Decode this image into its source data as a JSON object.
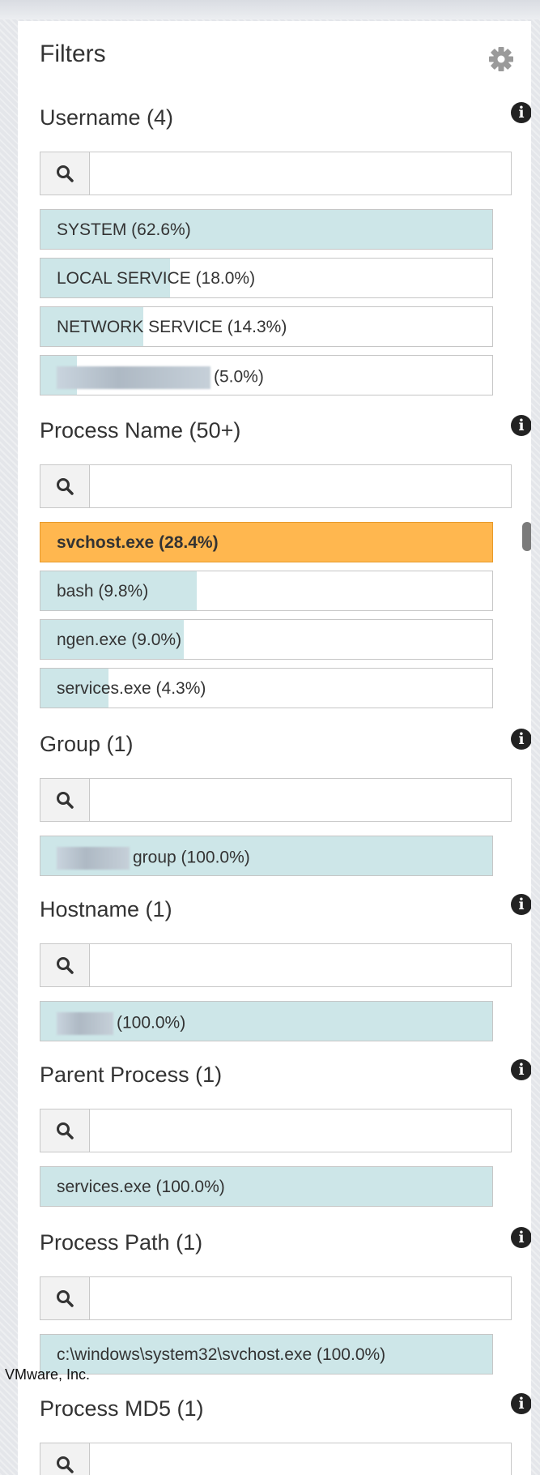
{
  "panel": {
    "title": "Filters",
    "settings_icon": "gear-icon"
  },
  "colors": {
    "bar_fill": "#cde6e8",
    "selected": "#ffb74f",
    "background": "#e4e6ea"
  },
  "sections": [
    {
      "title": "Username (4)",
      "search_placeholder": "",
      "items": [
        {
          "label": "SYSTEM (62.6%)",
          "percent": 100,
          "redacted": false,
          "selected": false
        },
        {
          "label": "LOCAL SERVICE (18.0%)",
          "percent": 28.75,
          "redacted": false,
          "selected": false
        },
        {
          "label": "NETWORK SERVICE (14.3%)",
          "percent": 22.84,
          "redacted": false,
          "selected": false
        },
        {
          "label": "(5.0%)",
          "percent": 7.99,
          "redacted": true,
          "selected": false
        }
      ]
    },
    {
      "title": "Process Name (50+)",
      "search_placeholder": "",
      "items": [
        {
          "label": "svchost.exe (28.4%)",
          "percent": 100,
          "redacted": false,
          "selected": true
        },
        {
          "label": "bash (9.8%)",
          "percent": 34.51,
          "redacted": false,
          "selected": false
        },
        {
          "label": "ngen.exe (9.0%)",
          "percent": 31.69,
          "redacted": false,
          "selected": false
        },
        {
          "label": "services.exe (4.3%)",
          "percent": 15.14,
          "redacted": false,
          "selected": false
        }
      ]
    },
    {
      "title": "Group (1)",
      "search_placeholder": "",
      "items": [
        {
          "label": "group (100.0%)",
          "percent": 100,
          "redacted": true,
          "selected": false
        }
      ]
    },
    {
      "title": "Hostname (1)",
      "search_placeholder": "",
      "items": [
        {
          "label": "(100.0%)",
          "percent": 100,
          "redacted": true,
          "selected": false
        }
      ]
    },
    {
      "title": "Parent Process (1)",
      "search_placeholder": "",
      "items": [
        {
          "label": "services.exe (100.0%)",
          "percent": 100,
          "redacted": false,
          "selected": false
        }
      ]
    },
    {
      "title": "Process Path (1)",
      "search_placeholder": "",
      "items": [
        {
          "label": "c:\\windows\\system32\\svchost.exe (100.0%)",
          "percent": 100,
          "redacted": false,
          "selected": false
        }
      ]
    },
    {
      "title": "Process MD5 (1)",
      "search_placeholder": "",
      "items": []
    }
  ],
  "footer": {
    "text": "VMware, Inc."
  }
}
